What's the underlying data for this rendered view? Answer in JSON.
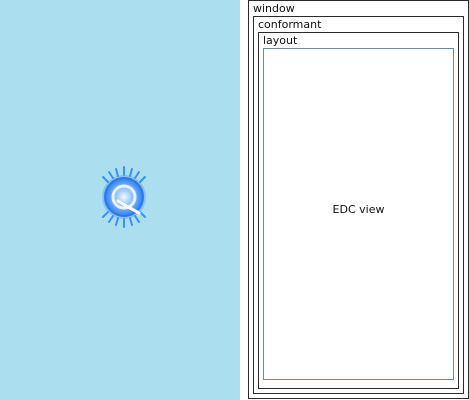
{
  "preview": {
    "background": "#abdeef",
    "logo_icon": "enlightenment-logo-icon",
    "logo_color": "#3f95f7"
  },
  "object_tree": {
    "window": {
      "label": "window"
    },
    "conformant": {
      "label": "conformant"
    },
    "layout": {
      "label": "layout"
    },
    "edc_view": {
      "label": "EDC view"
    }
  }
}
